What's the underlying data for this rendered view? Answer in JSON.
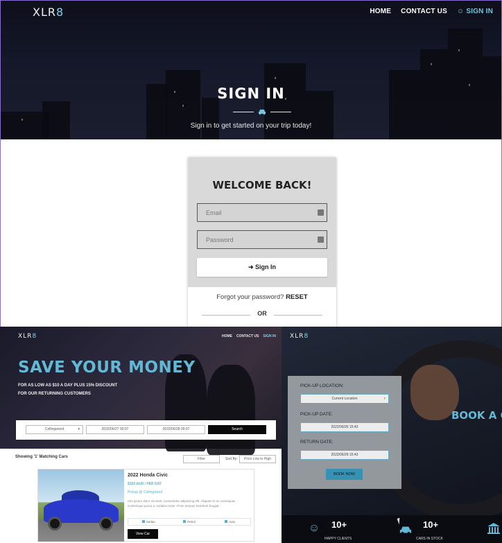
{
  "signin_page": {
    "logo": {
      "main": "XLR",
      "accent": "8"
    },
    "nav": {
      "home": "HOME",
      "contact": "CONTACT US",
      "signin": "SIGN IN"
    },
    "hero_title": "SIGN IN",
    "hero_subtitle": "Sign in to get started on your trip today!",
    "card_title": "WELCOME BACK!",
    "email_placeholder": "Email",
    "password_placeholder": "Password",
    "signin_button": "Sign In",
    "forgot_text": "Forgot your password?",
    "reset_link": "RESET",
    "or_text": "OR"
  },
  "save_page": {
    "logo": {
      "main": "XLR",
      "accent": "8"
    },
    "nav": {
      "home": "HOME",
      "contact": "CONTACT US",
      "signin": "SIGN IN"
    },
    "title": "SAVE YOUR MONEY",
    "subtitle_line1": "FOR AS LOW AS $10 A DAY PLUS 15% DISCOUNT",
    "subtitle_line2": "FOR OUR RETURNING CUSTOMERS",
    "search": {
      "location": "Collingwood",
      "pickup_date": "2022/06/27 00:07",
      "return_date": "2022/06/28 00:07",
      "button": "Search"
    },
    "results_count": "Showing '1' Matching Cars",
    "filter_label": "Filter",
    "sort_by_label": "Sort By:",
    "sort_value": "Price Low to High",
    "car": {
      "name": "2022 Honda Civic",
      "price": "$150 AUD / PER DAY",
      "pickup": "Pickup @ Collingwood",
      "description": "rem ipsum dolor sit amet, consectetur adipiscing elit. Aliquam in ex consequat, scelerisque purus a, sodales tortor. Proin tempus hendrerit feugiat.",
      "tags": [
        "Sedan",
        "Petrol",
        "Auto"
      ],
      "view_button": "View Car"
    }
  },
  "booking_page": {
    "logo": {
      "main": "XLR",
      "accent": "8"
    },
    "pickup_location_label": "PICK-UP LOCATION:",
    "pickup_location_value": "Current Location",
    "pickup_date_label": "PICK-UP DATE:",
    "pickup_date_value": "2022/06/26 15:43",
    "return_date_label": "RETURN DATE:",
    "return_date_value": "2022/06/29 15:43",
    "book_button": "BOOK NOW",
    "heading": "BOOK A C",
    "stats": [
      {
        "icon": "smiley-icon",
        "value": "10+",
        "caption": "HAPPY CLIENTS"
      },
      {
        "icon": "car-icon",
        "value": "10+",
        "caption": "CARS IN STOCK"
      }
    ]
  },
  "colors": {
    "accent": "#63b8d5",
    "dark": "#0a0a0a",
    "card": "#d9d9d9"
  }
}
